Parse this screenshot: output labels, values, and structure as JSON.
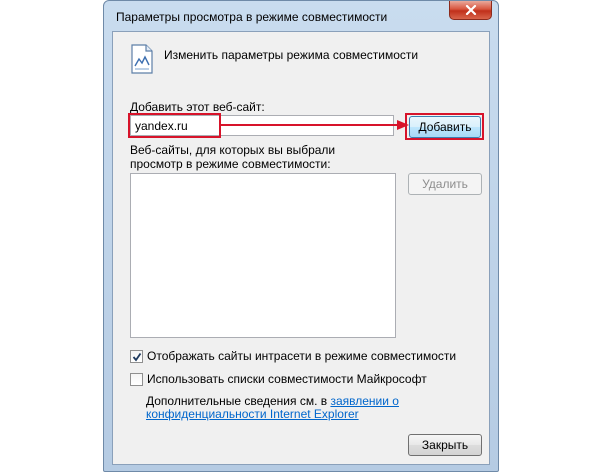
{
  "window": {
    "title": "Параметры просмотра в режиме совместимости"
  },
  "header": {
    "icon": "compat-view-page-icon",
    "text": "Изменить параметры режима совместимости"
  },
  "add_site": {
    "label": "Добавить этот веб-сайт:",
    "value": "yandex.ru",
    "add_label": "Добавить"
  },
  "site_list": {
    "label": "Веб-сайты, для которых вы выбрали просмотр в режиме совместимости:",
    "items": [],
    "remove_label": "Удалить"
  },
  "options": {
    "intranet_label": "Отображать сайты интрасети в режиме совместимости",
    "intranet_checked": true,
    "ms_lists_label": "Использовать списки совместимости Майкрософт",
    "ms_lists_checked": false
  },
  "info": {
    "prefix": "Дополнительные сведения см. в ",
    "link_text": "заявлении о конфиденциальности Internet Explorer"
  },
  "footer": {
    "close_label": "Закрыть"
  },
  "colors": {
    "highlight": "#d7132a",
    "link": "#0066cc"
  }
}
